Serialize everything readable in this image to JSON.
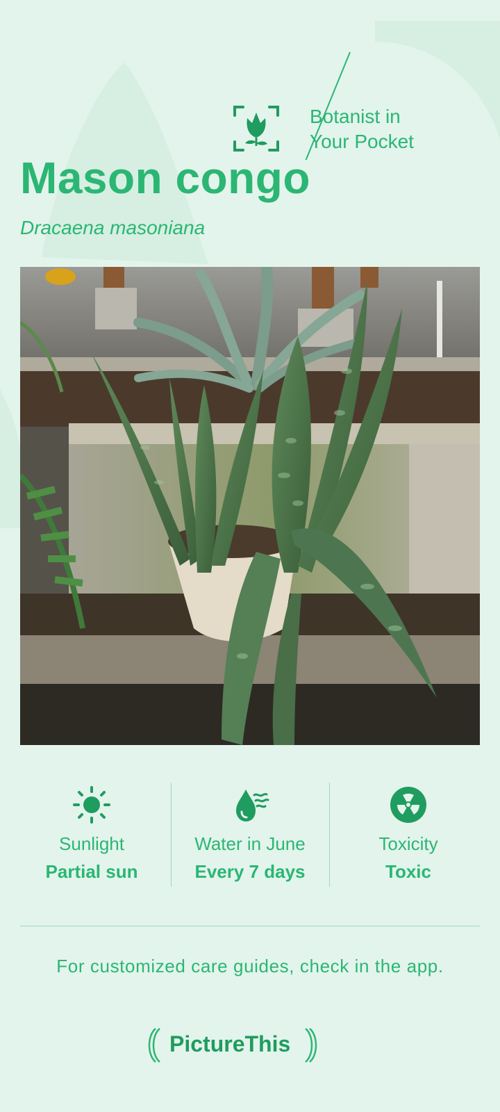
{
  "brand": {
    "tagline_line1": "Botanist in",
    "tagline_line2": "Your Pocket",
    "logo_text": "PictureThis"
  },
  "plant": {
    "common_name": "Mason congo",
    "latin_name": "Dracaena masoniana"
  },
  "care": [
    {
      "label": "Sunlight",
      "value": "Partial sun",
      "icon": "sun-icon"
    },
    {
      "label": "Water in June",
      "value": "Every 7 days",
      "icon": "water-drop-icon"
    },
    {
      "label": "Toxicity",
      "value": "Toxic",
      "icon": "toxicity-icon"
    }
  ],
  "footer": {
    "note": "For customized care guides, check in the app."
  },
  "colors": {
    "accent": "#2bb673",
    "background": "#e3f4ec"
  }
}
